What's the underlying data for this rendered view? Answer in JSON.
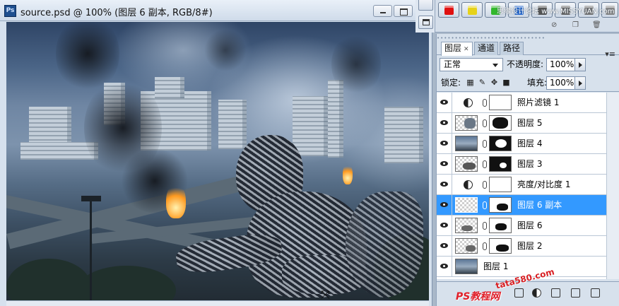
{
  "document": {
    "title": "source.psd @ 100% (图层 6 副本, RGB/8#)",
    "app_icon": "Ps"
  },
  "styles_strip": {
    "watermark": "思缘设计论坛  www.MISSYUAN.com"
  },
  "layers_panel": {
    "tabs": [
      {
        "label": "图层",
        "active": true
      },
      {
        "label": "通道",
        "active": false
      },
      {
        "label": "路径",
        "active": false
      }
    ],
    "blend_mode": "正常",
    "opacity_label": "不透明度:",
    "opacity_value": "100%",
    "lock_label": "锁定:",
    "fill_label": "填充:",
    "fill_value": "100%",
    "layers": [
      {
        "name": "照片滤镜 1",
        "type": "adjustment",
        "selected": false
      },
      {
        "name": "图层 5",
        "type": "masked",
        "selected": false
      },
      {
        "name": "图层 4",
        "type": "masked",
        "selected": false
      },
      {
        "name": "图层 3",
        "type": "masked",
        "selected": false
      },
      {
        "name": "亮度/对比度 1",
        "type": "adjustment",
        "selected": false
      },
      {
        "name": "图层 6 副本",
        "type": "masked",
        "selected": true
      },
      {
        "name": "图层 6",
        "type": "masked",
        "selected": false
      },
      {
        "name": "图层 2",
        "type": "masked",
        "selected": false
      },
      {
        "name": "图层 1",
        "type": "plain",
        "selected": false
      }
    ],
    "watermark_bottom": "PS教程网",
    "watermark_side": "tata580.com"
  },
  "icons": {
    "eye": "eye-icon",
    "link": "link-icon",
    "adjustment": "adjustment-circle-icon"
  },
  "colors": {
    "selection": "#3399ff",
    "watermark_red": "#e0202a"
  }
}
